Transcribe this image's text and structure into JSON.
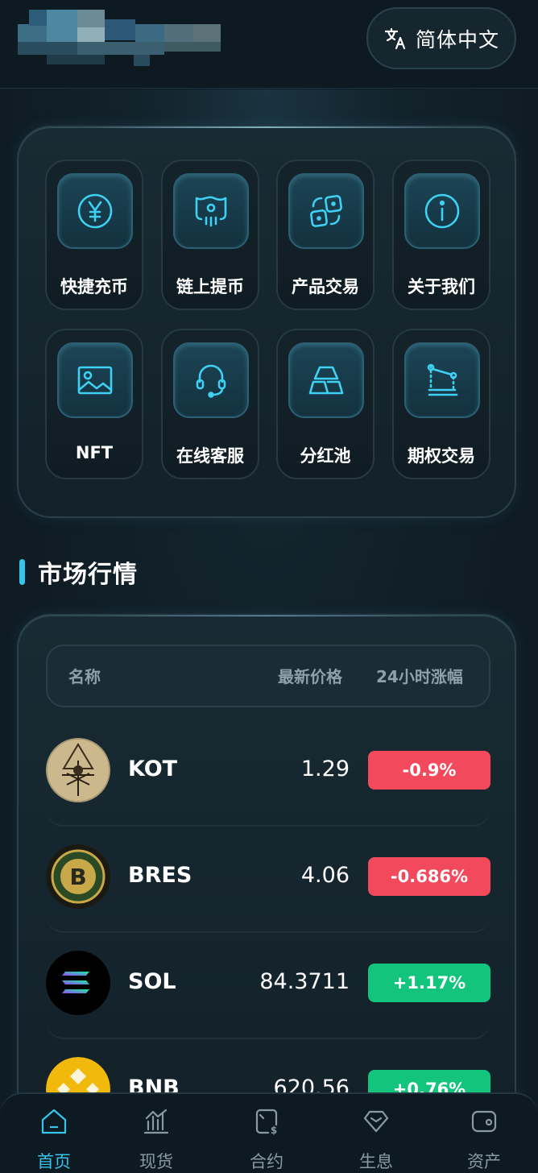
{
  "header": {
    "language_label": "简体中文",
    "icons": {
      "translate": "translate-icon"
    }
  },
  "quick_menu": {
    "items": [
      {
        "label": "快捷充币",
        "icon": "yen-coin-icon"
      },
      {
        "label": "链上提币",
        "icon": "withdraw-wallet-icon"
      },
      {
        "label": "产品交易",
        "icon": "swap-exchange-icon"
      },
      {
        "label": "关于我们",
        "icon": "info-icon"
      },
      {
        "label": "NFT",
        "icon": "image-icon"
      },
      {
        "label": "在线客服",
        "icon": "headset-icon"
      },
      {
        "label": "分红池",
        "icon": "gold-bars-icon"
      },
      {
        "label": "期权交易",
        "icon": "chart-line-icon"
      }
    ]
  },
  "market": {
    "title": "市场行情",
    "columns": {
      "name": "名称",
      "price": "最新价格",
      "change": "24小时涨幅"
    },
    "rows": [
      {
        "symbol": "KOT",
        "price": "1.29",
        "change": "-0.9%",
        "direction": "down"
      },
      {
        "symbol": "BRES",
        "price": "4.06",
        "change": "-0.686%",
        "direction": "down"
      },
      {
        "symbol": "SOL",
        "price": "84.3711",
        "change": "+1.17%",
        "direction": "up"
      },
      {
        "symbol": "BNB",
        "price": "620.56",
        "change": "+0.76%",
        "direction": "up"
      }
    ]
  },
  "colors": {
    "accent": "#35c4ec",
    "down": "#f24a5c",
    "up": "#12c47c",
    "background": "#0f1c24"
  },
  "bottom_nav": {
    "items": [
      {
        "label": "首页",
        "icon": "home-icon",
        "active": true
      },
      {
        "label": "现货",
        "icon": "spot-chart-icon",
        "active": false
      },
      {
        "label": "合约",
        "icon": "contract-doc-icon",
        "active": false
      },
      {
        "label": "生息",
        "icon": "diamond-icon",
        "active": false
      },
      {
        "label": "资产",
        "icon": "wallet-icon",
        "active": false
      }
    ]
  }
}
